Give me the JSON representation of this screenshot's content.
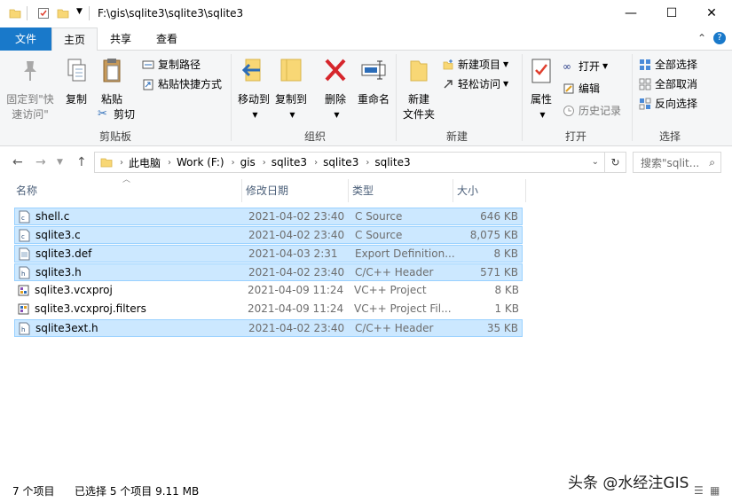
{
  "window": {
    "path_title": "F:\\gis\\sqlite3\\sqlite3\\sqlite3",
    "minimize": "—",
    "maximize": "☐",
    "close": "✕"
  },
  "ribbon_tabs": {
    "file": "文件",
    "home": "主页",
    "share": "共享",
    "view": "查看"
  },
  "ribbon": {
    "clipboard": {
      "group": "剪贴板",
      "pin_line1": "固定到\"快",
      "pin_line2": "速访问\"",
      "copy": "复制",
      "paste": "粘贴",
      "copy_path": "复制路径",
      "paste_shortcut": "粘贴快捷方式",
      "cut": "剪切"
    },
    "organize": {
      "group": "组织",
      "move_to": "移动到",
      "copy_to": "复制到",
      "delete": "删除",
      "rename": "重命名"
    },
    "new": {
      "group": "新建",
      "new_folder_line1": "新建",
      "new_folder_line2": "文件夹",
      "new_item": "新建项目",
      "easy_access": "轻松访问"
    },
    "open": {
      "group": "打开",
      "properties": "属性",
      "open": "打开",
      "edit": "编辑",
      "history": "历史记录"
    },
    "select": {
      "group": "选择",
      "select_all": "全部选择",
      "select_none": "全部取消",
      "invert": "反向选择"
    }
  },
  "address": {
    "crumbs": [
      "此电脑",
      "Work (F:)",
      "gis",
      "sqlite3",
      "sqlite3",
      "sqlite3"
    ],
    "search_placeholder": "搜索\"sqlit..."
  },
  "columns": {
    "name": "名称",
    "modified": "修改日期",
    "type": "类型",
    "size": "大小"
  },
  "files": [
    {
      "name": "shell.c",
      "date": "2021-04-02 23:40",
      "type": "C Source",
      "size": "646 KB",
      "selected": true,
      "icon": "c-file-icon"
    },
    {
      "name": "sqlite3.c",
      "date": "2021-04-02 23:40",
      "type": "C Source",
      "size": "8,075 KB",
      "selected": true,
      "icon": "c-file-icon"
    },
    {
      "name": "sqlite3.def",
      "date": "2021-04-03 2:31",
      "type": "Export Definition...",
      "size": "8 KB",
      "selected": true,
      "icon": "def-file-icon"
    },
    {
      "name": "sqlite3.h",
      "date": "2021-04-02 23:40",
      "type": "C/C++ Header",
      "size": "571 KB",
      "selected": true,
      "icon": "h-file-icon"
    },
    {
      "name": "sqlite3.vcxproj",
      "date": "2021-04-09 11:24",
      "type": "VC++ Project",
      "size": "8 KB",
      "selected": false,
      "icon": "vcxproj-file-icon"
    },
    {
      "name": "sqlite3.vcxproj.filters",
      "date": "2021-04-09 11:24",
      "type": "VC++ Project Fil...",
      "size": "1 KB",
      "selected": false,
      "icon": "filters-file-icon"
    },
    {
      "name": "sqlite3ext.h",
      "date": "2021-04-02 23:40",
      "type": "C/C++ Header",
      "size": "35 KB",
      "selected": true,
      "icon": "h-file-icon"
    }
  ],
  "status": {
    "item_count": "7 个项目",
    "selected": "已选择 5 个项目  9.11 MB"
  },
  "watermark": "头条 @水经注GIS",
  "colors": {
    "accent": "#1979ca",
    "selection_bg": "#cce8ff",
    "selection_border": "#99d1ff",
    "folder": "#f8d775"
  }
}
